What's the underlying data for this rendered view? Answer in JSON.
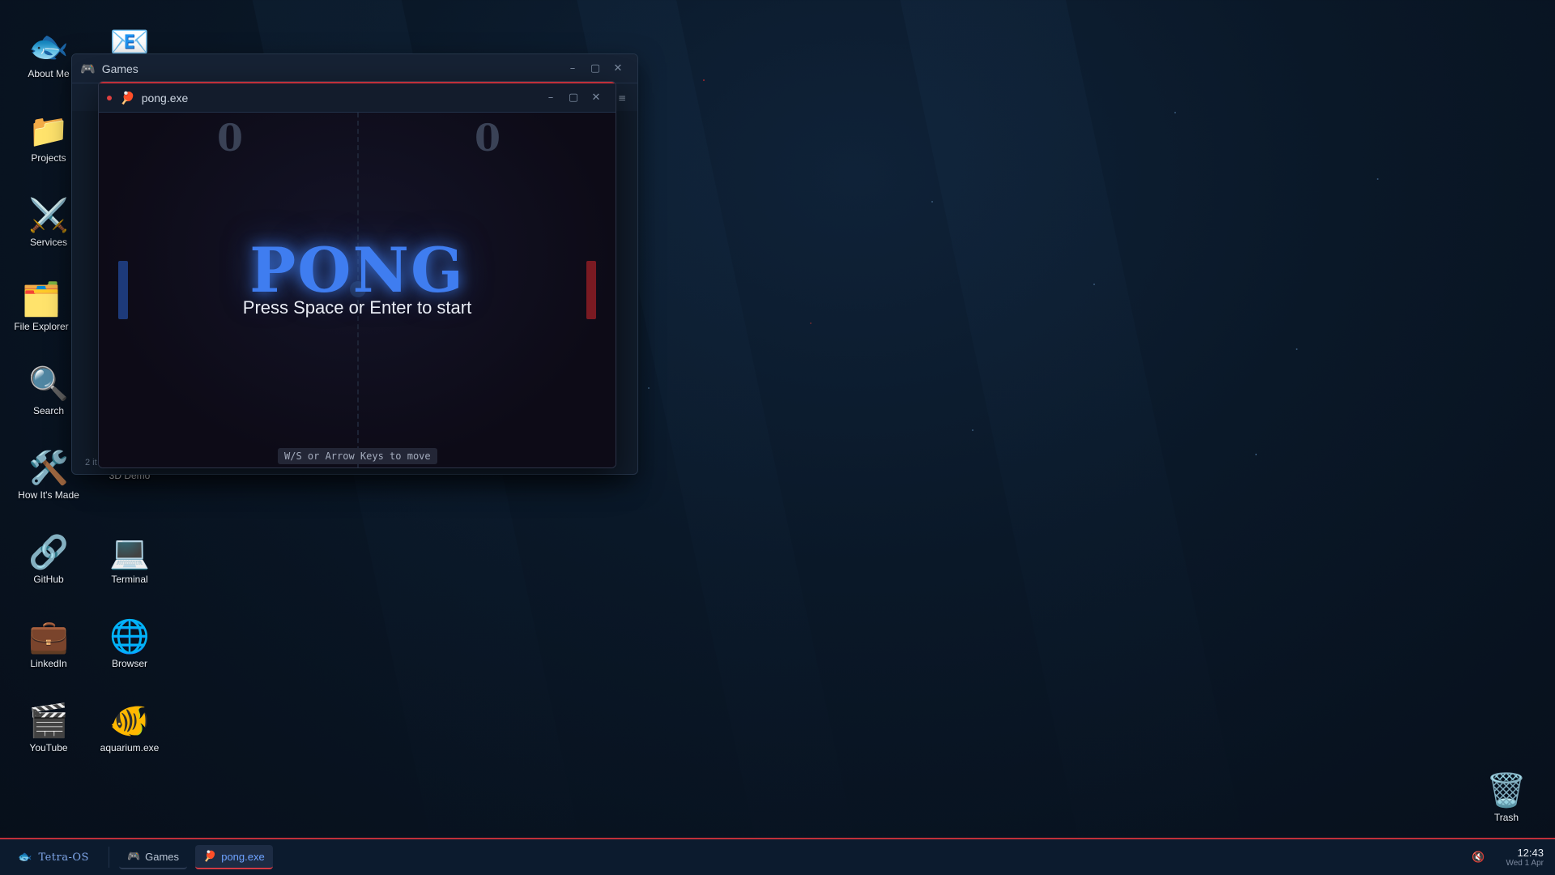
{
  "desktop": {
    "icons": [
      {
        "label": "About Me",
        "glyph": "🐟"
      },
      {
        "label": "Projects",
        "glyph": "📁"
      },
      {
        "label": "Services",
        "glyph": "⚔️"
      },
      {
        "label": "File Explorer",
        "glyph": "🗂️"
      },
      {
        "label": "Search",
        "glyph": "🔍"
      },
      {
        "label": "How It's Made",
        "glyph": "🛠️"
      },
      {
        "label": "GitHub",
        "glyph": "🔗"
      },
      {
        "label": "LinkedIn",
        "glyph": "💼"
      },
      {
        "label": "YouTube",
        "glyph": "🎬"
      },
      {
        "label": "",
        "glyph": "📧"
      },
      {
        "label": "3D Demo",
        "glyph": ""
      },
      {
        "label": "Terminal",
        "glyph": "💻"
      },
      {
        "label": "Browser",
        "glyph": "🌐"
      },
      {
        "label": "aquarium.exe",
        "glyph": "🐠"
      },
      {
        "label": "Trash",
        "glyph": "🗑️"
      }
    ]
  },
  "games_window": {
    "title": "Games",
    "icon": "🎮",
    "status_text": "2 it",
    "controls": {
      "minimize": "–",
      "maximize": "▢",
      "close": "✕"
    },
    "menu_icon": "≡"
  },
  "pong_window": {
    "title": "pong.exe",
    "icon": "🏓",
    "controls": {
      "minimize": "–",
      "maximize": "▢",
      "close": "✕"
    },
    "score_left": "0",
    "score_right": "0",
    "game_title": "PONG",
    "start_prompt": "Press Space or Enter to start",
    "controls_hint": "W/S or Arrow Keys to move",
    "colors": {
      "left_paddle": "#1d3a7a",
      "right_paddle": "#7a1a22",
      "title_glow": "#3f7df0"
    }
  },
  "taskbar": {
    "brand_icon": "🐟",
    "brand": "Tetra-OS",
    "items": [
      {
        "label": "Games",
        "icon": "🎮",
        "active": false
      },
      {
        "label": "pong.exe",
        "icon": "🏓",
        "active": true
      }
    ],
    "mute_icon": "🔇",
    "time": "12:43",
    "date": "Wed 1 Apr"
  },
  "accent_color": "#c0303a"
}
